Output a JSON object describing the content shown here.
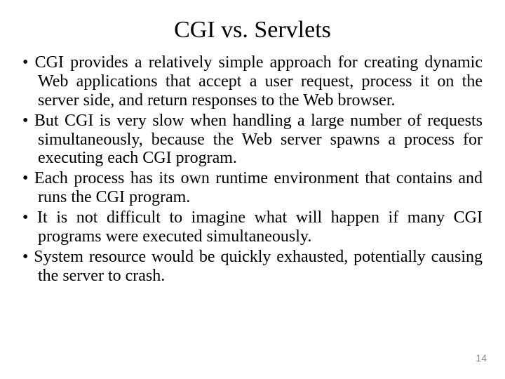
{
  "title": "CGI vs. Servlets",
  "bullets": [
    "CGI provides a relatively simple approach for creating dynamic Web applications that accept a user request, process it on the server side, and return responses to the Web browser.",
    "But CGI is very slow when handling a large number of requests simultaneously, because the Web server spawns a process for executing each CGI program.",
    "Each process has its own runtime environment that contains and runs the CGI program.",
    "It is not difficult to imagine what will happen if many CGI programs were executed simultaneously.",
    "System resource would be quickly exhausted, potentially causing the server to crash."
  ],
  "page_number": "14"
}
